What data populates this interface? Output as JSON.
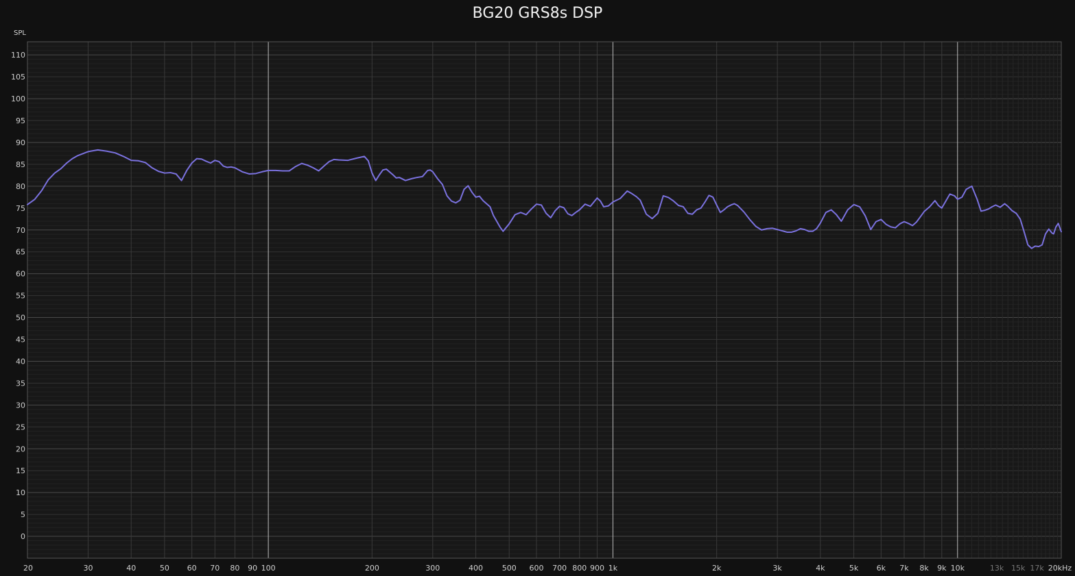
{
  "chart_data": {
    "type": "line",
    "title": "BG20 GRS8s DSP",
    "ylabel": "SPL",
    "xlabel": "",
    "x_scale": "log",
    "xlim": [
      20,
      20000
    ],
    "ylim": [
      -5,
      113
    ],
    "grid": true,
    "colors": {
      "background": "#111111",
      "plot_background": "#181818",
      "series": "#7b72e0",
      "grid_major": "#bdbdbd",
      "grid_minor": "#3a3a3a",
      "tick_text": "#d0d0d0",
      "tick_text_dim": "#777777"
    },
    "y_ticks": [
      "110",
      "105",
      "100",
      "95",
      "90",
      "85",
      "80",
      "75",
      "70",
      "65",
      "60",
      "55",
      "50",
      "45",
      "40",
      "35",
      "30",
      "25",
      "20",
      "15",
      "10",
      "5",
      "0"
    ],
    "y_tick_values": [
      110,
      105,
      100,
      95,
      90,
      85,
      80,
      75,
      70,
      65,
      60,
      55,
      50,
      45,
      40,
      35,
      30,
      25,
      20,
      15,
      10,
      5,
      0
    ],
    "x_ticks": [
      {
        "value": 20,
        "label": "20"
      },
      {
        "value": 30,
        "label": "30"
      },
      {
        "value": 40,
        "label": "40"
      },
      {
        "value": 50,
        "label": "50"
      },
      {
        "value": 60,
        "label": "60"
      },
      {
        "value": 70,
        "label": "70"
      },
      {
        "value": 80,
        "label": "80"
      },
      {
        "value": 90,
        "label": "90"
      },
      {
        "value": 100,
        "label": "100"
      },
      {
        "value": 200,
        "label": "200"
      },
      {
        "value": 300,
        "label": "300"
      },
      {
        "value": 400,
        "label": "400"
      },
      {
        "value": 500,
        "label": "500"
      },
      {
        "value": 600,
        "label": "600"
      },
      {
        "value": 700,
        "label": "700"
      },
      {
        "value": 800,
        "label": "800"
      },
      {
        "value": 900,
        "label": "900"
      },
      {
        "value": 1000,
        "label": "1k"
      },
      {
        "value": 2000,
        "label": "2k"
      },
      {
        "value": 3000,
        "label": "3k"
      },
      {
        "value": 4000,
        "label": "4k"
      },
      {
        "value": 5000,
        "label": "5k"
      },
      {
        "value": 6000,
        "label": "6k"
      },
      {
        "value": 7000,
        "label": "7k"
      },
      {
        "value": 8000,
        "label": "8k"
      },
      {
        "value": 9000,
        "label": "9k"
      },
      {
        "value": 10000,
        "label": "10k"
      },
      {
        "value": 13000,
        "label": "13k",
        "dim": true
      },
      {
        "value": 15000,
        "label": "15k",
        "dim": true
      },
      {
        "value": 17000,
        "label": "17k",
        "dim": true
      },
      {
        "value": 20000,
        "label": "20kHz"
      }
    ],
    "series": [
      {
        "name": "",
        "color": "#7b72e0",
        "points": [
          [
            20,
            75.8
          ],
          [
            21,
            77
          ],
          [
            22,
            79
          ],
          [
            23,
            81.5
          ],
          [
            24,
            83
          ],
          [
            25,
            84
          ],
          [
            26,
            85.3
          ],
          [
            27,
            86.3
          ],
          [
            28,
            87
          ],
          [
            30,
            87.9
          ],
          [
            32,
            88.3
          ],
          [
            34,
            88
          ],
          [
            36,
            87.6
          ],
          [
            38,
            86.8
          ],
          [
            40,
            85.9
          ],
          [
            42,
            85.8
          ],
          [
            44,
            85.4
          ],
          [
            46,
            84.2
          ],
          [
            48,
            83.4
          ],
          [
            50,
            83
          ],
          [
            52,
            83.1
          ],
          [
            54,
            82.8
          ],
          [
            56,
            81.3
          ],
          [
            58,
            83.6
          ],
          [
            60,
            85.3
          ],
          [
            62,
            86.3
          ],
          [
            64,
            86.2
          ],
          [
            66,
            85.7
          ],
          [
            68,
            85.3
          ],
          [
            70,
            85.9
          ],
          [
            72,
            85.6
          ],
          [
            74,
            84.6
          ],
          [
            76,
            84.3
          ],
          [
            78,
            84.4
          ],
          [
            80,
            84.2
          ],
          [
            84,
            83.3
          ],
          [
            88,
            82.8
          ],
          [
            92,
            82.9
          ],
          [
            96,
            83.3
          ],
          [
            100,
            83.6
          ],
          [
            105,
            83.6
          ],
          [
            110,
            83.5
          ],
          [
            115,
            83.5
          ],
          [
            120,
            84.5
          ],
          [
            125,
            85.2
          ],
          [
            130,
            84.8
          ],
          [
            135,
            84.2
          ],
          [
            140,
            83.5
          ],
          [
            145,
            84.6
          ],
          [
            150,
            85.6
          ],
          [
            155,
            86.1
          ],
          [
            160,
            86
          ],
          [
            170,
            85.9
          ],
          [
            180,
            86.4
          ],
          [
            190,
            86.8
          ],
          [
            195,
            85.8
          ],
          [
            200,
            83
          ],
          [
            205,
            81.3
          ],
          [
            210,
            82.6
          ],
          [
            215,
            83.7
          ],
          [
            220,
            83.9
          ],
          [
            230,
            82.6
          ],
          [
            235,
            81.9
          ],
          [
            240,
            82
          ],
          [
            250,
            81.3
          ],
          [
            260,
            81.7
          ],
          [
            270,
            82
          ],
          [
            280,
            82.2
          ],
          [
            290,
            83.6
          ],
          [
            295,
            83.7
          ],
          [
            300,
            83.3
          ],
          [
            310,
            81.7
          ],
          [
            320,
            80.4
          ],
          [
            330,
            77.8
          ],
          [
            340,
            76.6
          ],
          [
            350,
            76.2
          ],
          [
            360,
            76.8
          ],
          [
            370,
            79.3
          ],
          [
            380,
            80.1
          ],
          [
            390,
            78.6
          ],
          [
            400,
            77.5
          ],
          [
            410,
            77.7
          ],
          [
            420,
            76.7
          ],
          [
            440,
            75.3
          ],
          [
            450,
            73.3
          ],
          [
            470,
            70.7
          ],
          [
            480,
            69.7
          ],
          [
            500,
            71.4
          ],
          [
            520,
            73.5
          ],
          [
            540,
            74
          ],
          [
            560,
            73.5
          ],
          [
            580,
            74.8
          ],
          [
            600,
            75.9
          ],
          [
            620,
            75.7
          ],
          [
            640,
            73.8
          ],
          [
            660,
            72.8
          ],
          [
            680,
            74.4
          ],
          [
            700,
            75.4
          ],
          [
            720,
            75.1
          ],
          [
            740,
            73.7
          ],
          [
            760,
            73.3
          ],
          [
            780,
            74
          ],
          [
            800,
            74.6
          ],
          [
            830,
            75.9
          ],
          [
            860,
            75.4
          ],
          [
            900,
            77.3
          ],
          [
            920,
            76.6
          ],
          [
            940,
            75.3
          ],
          [
            970,
            75.5
          ],
          [
            1000,
            76.4
          ],
          [
            1050,
            77.2
          ],
          [
            1100,
            78.9
          ],
          [
            1130,
            78.4
          ],
          [
            1170,
            77.6
          ],
          [
            1200,
            76.8
          ],
          [
            1250,
            73.6
          ],
          [
            1300,
            72.6
          ],
          [
            1350,
            73.8
          ],
          [
            1400,
            77.8
          ],
          [
            1450,
            77.4
          ],
          [
            1500,
            76.6
          ],
          [
            1550,
            75.6
          ],
          [
            1600,
            75.3
          ],
          [
            1650,
            73.8
          ],
          [
            1700,
            73.6
          ],
          [
            1750,
            74.6
          ],
          [
            1800,
            75
          ],
          [
            1850,
            76.4
          ],
          [
            1900,
            77.9
          ],
          [
            1950,
            77.5
          ],
          [
            2000,
            75.7
          ],
          [
            2050,
            74
          ],
          [
            2100,
            74.6
          ],
          [
            2150,
            75.3
          ],
          [
            2200,
            75.7
          ],
          [
            2250,
            76
          ],
          [
            2300,
            75.6
          ],
          [
            2400,
            74.1
          ],
          [
            2500,
            72.3
          ],
          [
            2600,
            70.8
          ],
          [
            2700,
            70
          ],
          [
            2800,
            70.3
          ],
          [
            2900,
            70.4
          ],
          [
            3000,
            70.1
          ],
          [
            3100,
            69.8
          ],
          [
            3200,
            69.5
          ],
          [
            3300,
            69.5
          ],
          [
            3400,
            69.8
          ],
          [
            3500,
            70.3
          ],
          [
            3600,
            70.1
          ],
          [
            3700,
            69.7
          ],
          [
            3800,
            69.7
          ],
          [
            3900,
            70.3
          ],
          [
            4000,
            71.6
          ],
          [
            4150,
            74
          ],
          [
            4300,
            74.6
          ],
          [
            4450,
            73.5
          ],
          [
            4600,
            72
          ],
          [
            4800,
            74.6
          ],
          [
            5000,
            75.8
          ],
          [
            5200,
            75.3
          ],
          [
            5400,
            73.2
          ],
          [
            5600,
            70.1
          ],
          [
            5800,
            71.9
          ],
          [
            6000,
            72.4
          ],
          [
            6200,
            71.3
          ],
          [
            6400,
            70.7
          ],
          [
            6600,
            70.5
          ],
          [
            6800,
            71.4
          ],
          [
            7000,
            71.9
          ],
          [
            7200,
            71.5
          ],
          [
            7400,
            71
          ],
          [
            7600,
            71.8
          ],
          [
            7800,
            73
          ],
          [
            8000,
            74.2
          ],
          [
            8300,
            75.3
          ],
          [
            8600,
            76.7
          ],
          [
            8800,
            75.6
          ],
          [
            9000,
            75
          ],
          [
            9200,
            76.3
          ],
          [
            9500,
            78.2
          ],
          [
            9800,
            77.8
          ],
          [
            10000,
            77
          ],
          [
            10300,
            77.5
          ],
          [
            10600,
            79.3
          ],
          [
            11000,
            80
          ],
          [
            11400,
            77
          ],
          [
            11700,
            74.3
          ],
          [
            12000,
            74.5
          ],
          [
            12300,
            74.8
          ],
          [
            12600,
            75.3
          ],
          [
            12900,
            75.7
          ],
          [
            13300,
            75.2
          ],
          [
            13700,
            76
          ],
          [
            14000,
            75.4
          ],
          [
            14400,
            74.4
          ],
          [
            14800,
            73.8
          ],
          [
            15200,
            72.5
          ],
          [
            15600,
            69.6
          ],
          [
            16000,
            66.6
          ],
          [
            16400,
            65.8
          ],
          [
            16800,
            66.3
          ],
          [
            17200,
            66.2
          ],
          [
            17600,
            66.6
          ],
          [
            18000,
            69.1
          ],
          [
            18400,
            70.2
          ],
          [
            18800,
            69.3
          ],
          [
            19000,
            69.1
          ],
          [
            19300,
            70.7
          ],
          [
            19600,
            71.5
          ],
          [
            20000,
            69.6
          ]
        ]
      }
    ]
  }
}
